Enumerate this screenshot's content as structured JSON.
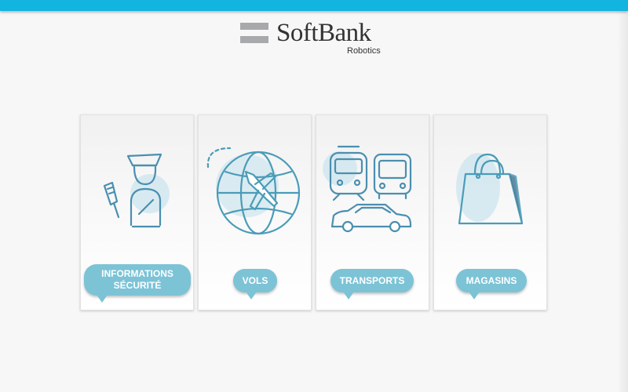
{
  "brand": {
    "name": "SoftBank",
    "subtitle": "Robotics"
  },
  "colors": {
    "accent": "#12b4e0",
    "bubble": "#7cc3d6",
    "icon_stroke": "#4a90a8",
    "icon_fill": "#cfe6ef"
  },
  "menu": {
    "items": [
      {
        "label": "INFORMATIONS\nSÉCURITÉ",
        "icon": "security-officer-icon"
      },
      {
        "label": "VOLS",
        "icon": "airplane-globe-icon"
      },
      {
        "label": "TRANSPORTS",
        "icon": "train-bus-car-icon"
      },
      {
        "label": "MAGASINS",
        "icon": "shopping-bag-icon"
      }
    ]
  }
}
